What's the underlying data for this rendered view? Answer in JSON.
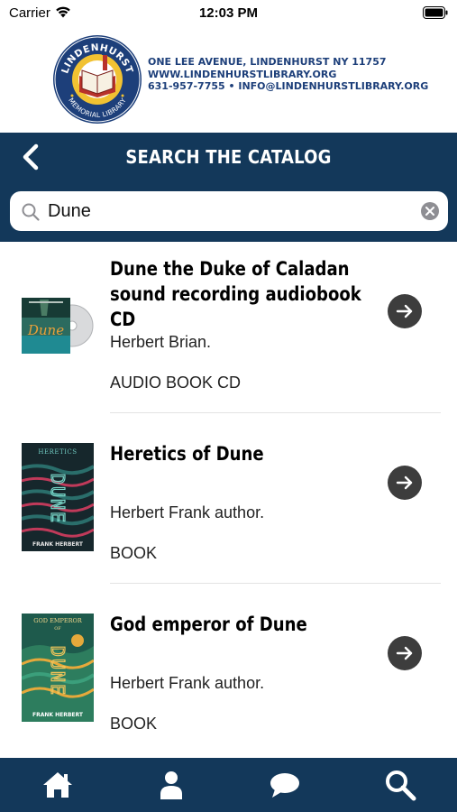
{
  "status_bar": {
    "carrier": "Carrier",
    "time": "12:03 PM"
  },
  "library": {
    "logo_text_top": "LINDENHURST",
    "logo_text_bottom": "MEMORIAL LIBRARY",
    "address": "ONE LEE AVENUE, LINDENHURST NY 11757",
    "website": "WWW.LINDENHURSTLIBRARY.ORG",
    "contact": "631-957-7755 • INFO@LINDENHURSTLIBRARY.ORG"
  },
  "nav": {
    "title": "SEARCH THE CATALOG",
    "back_icon": "chevron-left-icon"
  },
  "search": {
    "value": "Dune",
    "placeholder": "Search",
    "clear_icon": "clear-icon"
  },
  "results": [
    {
      "title": "Dune the Duke of Caladan sound recording audiobook CD",
      "author": "Herbert Brian.",
      "format": "AUDIO BOOK CD",
      "cover_text": "Dune"
    },
    {
      "title": "Heretics of Dune",
      "author": "Herbert Frank author.",
      "format": "BOOK",
      "cover_top": "HERETICS",
      "cover_text": "DUNE",
      "cover_bottom": "FRANK HERBERT"
    },
    {
      "title": "God emperor of Dune",
      "author": "Herbert Frank author.",
      "format": "BOOK",
      "cover_top": "GOD EMPEROR",
      "cover_of": "OF",
      "cover_text": "DUNE",
      "cover_bottom": "FRANK HERBERT"
    }
  ],
  "tab_bar": {
    "items": [
      "home-icon",
      "profile-icon",
      "chat-icon",
      "search-icon"
    ]
  },
  "colors": {
    "navy": "#13385a",
    "arrow": "#3d3d3d",
    "logo_blue": "#1d3f7a"
  }
}
